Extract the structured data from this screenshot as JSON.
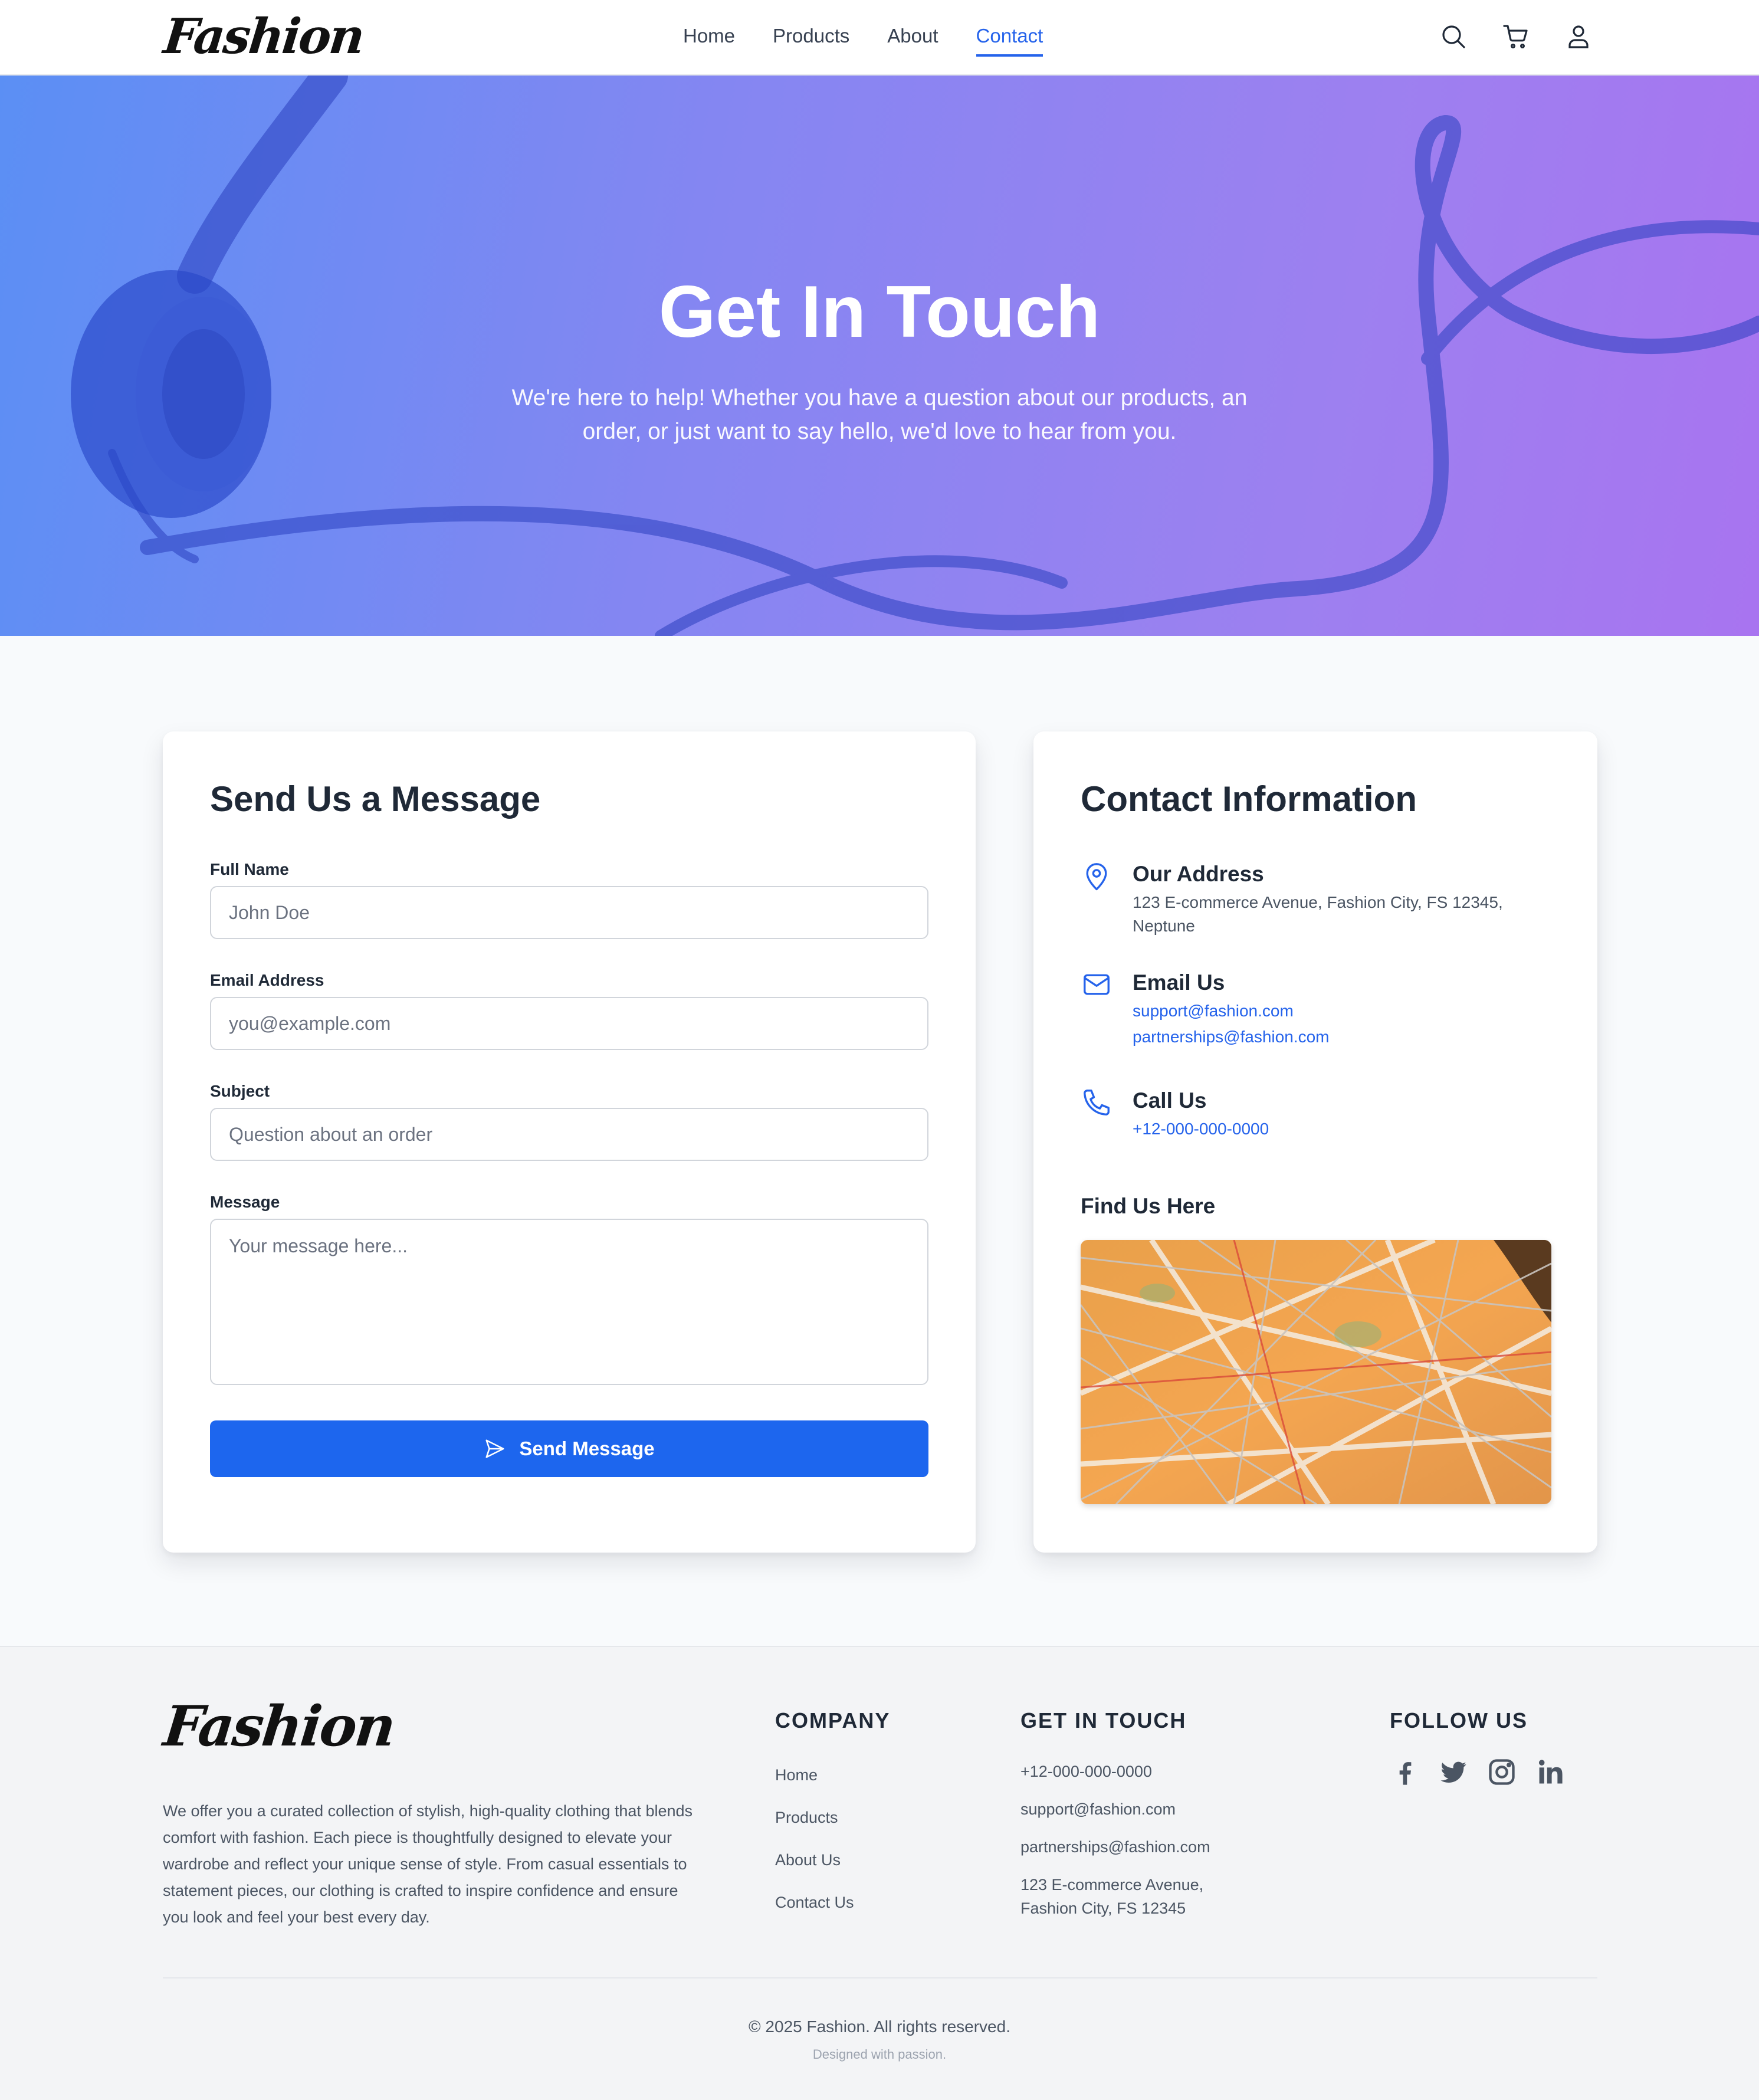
{
  "brand": {
    "logo_text": "Fashion"
  },
  "nav": {
    "items": [
      {
        "label": "Home",
        "active": false
      },
      {
        "label": "Products",
        "active": false
      },
      {
        "label": "About",
        "active": false
      },
      {
        "label": "Contact",
        "active": true
      }
    ],
    "icons": [
      "search-icon",
      "cart-icon",
      "user-icon"
    ]
  },
  "hero": {
    "title": "Get In Touch",
    "subtitle": "We're here to help! Whether you have a question about our products, an order, or just want to say hello, we'd love to hear from you."
  },
  "form": {
    "title": "Send Us a Message",
    "fields": [
      {
        "label": "Full Name",
        "placeholder": "John Doe"
      },
      {
        "label": "Email Address",
        "placeholder": "you@example.com"
      },
      {
        "label": "Subject",
        "placeholder": "Question about an order"
      },
      {
        "label": "Message",
        "placeholder": "Your message here..."
      }
    ],
    "submit_label": "Send Message"
  },
  "contact": {
    "title": "Contact Information",
    "address": {
      "heading": "Our Address",
      "text": "123 E-commerce Avenue, Fashion City, FS 12345, Neptune"
    },
    "email": {
      "heading": "Email Us",
      "links": [
        "support@fashion.com",
        "partnerships@fashion.com"
      ]
    },
    "phone": {
      "heading": "Call Us",
      "number": "+12-000-000-0000"
    },
    "map_title": "Find Us Here"
  },
  "footer": {
    "logo_text": "Fashion",
    "description": "We offer you a curated collection of stylish, high-quality clothing that blends comfort with fashion. Each piece is thoughtfully designed to elevate your wardrobe and reflect your unique sense of style. From casual essentials to statement pieces, our clothing is crafted to inspire confidence and ensure you look and feel your best every day.",
    "company": {
      "title": "COMPANY",
      "links": [
        "Home",
        "Products",
        "About Us",
        "Contact Us"
      ]
    },
    "get_in_touch": {
      "title": "GET IN TOUCH",
      "phone": "+12-000-000-0000",
      "email_support": "support@fashion.com",
      "email_partners": "partnerships@fashion.com",
      "address_line1": "123 E-commerce Avenue,",
      "address_line2": "Fashion City, FS 12345"
    },
    "follow": {
      "title": "FOLLOW US",
      "icons": [
        "facebook-icon",
        "twitter-icon",
        "instagram-icon",
        "linkedin-icon"
      ]
    },
    "copyright": "© 2025 Fashion. All rights reserved.",
    "tagline": "Designed with passion."
  },
  "colors": {
    "accent": "#1d66ee",
    "link": "#2563eb",
    "hero_start": "#5b8ff4",
    "hero_end": "#a874f0"
  }
}
